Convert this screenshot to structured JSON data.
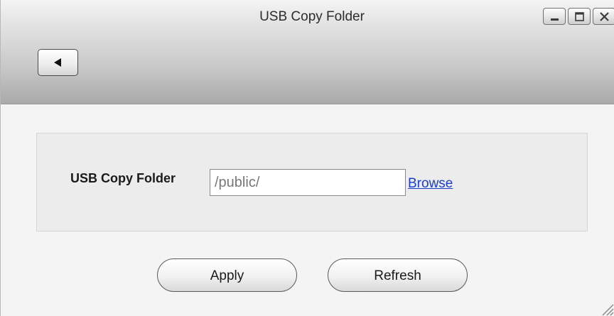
{
  "window": {
    "title": "USB Copy Folder",
    "controls": [
      "minimize-icon",
      "maximize-icon",
      "close-icon"
    ]
  },
  "toolbar": {
    "back_icon": "back-arrow-icon"
  },
  "form": {
    "field_label": "USB Copy Folder",
    "field_value": "/public/",
    "browse_label": "Browse"
  },
  "actions": {
    "apply_label": "Apply",
    "refresh_label": "Refresh"
  },
  "colors": {
    "link": "#1a3fc8",
    "background": "#f4f4f4"
  }
}
